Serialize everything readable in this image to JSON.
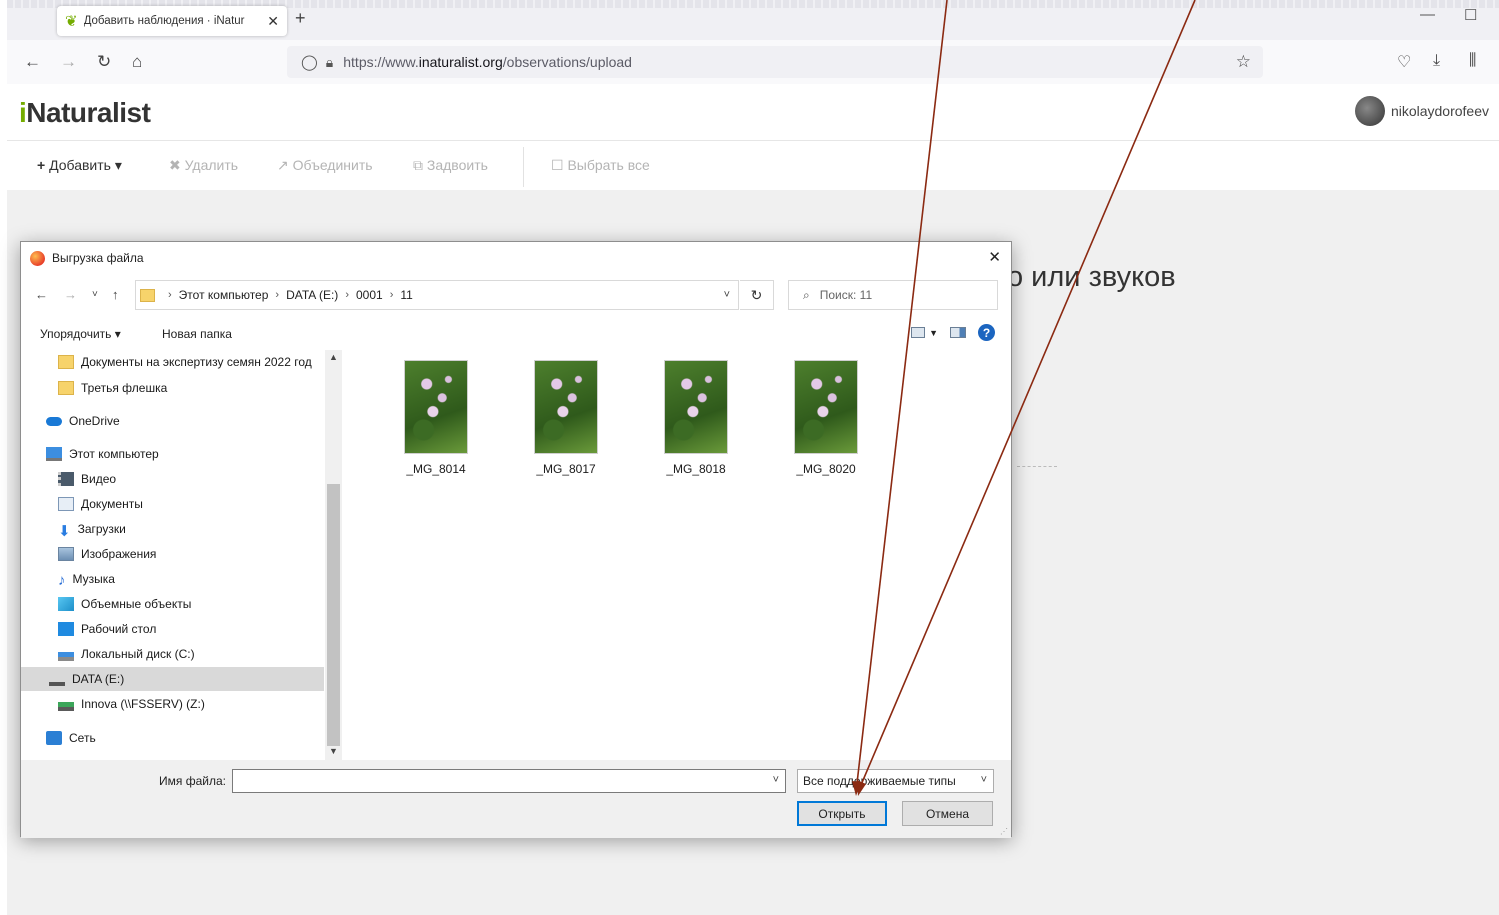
{
  "browser": {
    "tab_title": "Добавить наблюдения · iNatur",
    "tab_close": "✕",
    "new_tab": "+",
    "url_prefix": "https://www.",
    "url_domain": "inaturalist.org",
    "url_path": "/observations/upload"
  },
  "site": {
    "logo_i": "i",
    "logo_rest": "Naturalist",
    "username": "nikolaydorofeev",
    "toolbar": {
      "add": "Добавить",
      "delete": "Удалить",
      "merge": "Объединить",
      "duplicate": "Задвоить",
      "select_all": "Выбрать все"
    },
    "heading_partial": "о или звуков"
  },
  "dialog": {
    "title": "Выгрузка файла",
    "breadcrumb": [
      "Этот компьютер",
      "DATA (E:)",
      "0001",
      "11"
    ],
    "search_placeholder": "Поиск: 11",
    "organize": "Упорядочить ▾",
    "new_folder": "Новая папка",
    "nav_items": [
      {
        "label": "Документы на экспертизу семян 2022 год",
        "icon": "folder-icon"
      },
      {
        "label": "Третья флешка",
        "icon": "folder-icon"
      },
      {
        "label": "OneDrive",
        "icon": "cloud-icon"
      },
      {
        "label": "Этот компьютер",
        "icon": "computer-icon"
      },
      {
        "label": "Видео",
        "icon": "video-icon"
      },
      {
        "label": "Документы",
        "icon": "documents-icon"
      },
      {
        "label": "Загрузки",
        "icon": "download-icon"
      },
      {
        "label": "Изображения",
        "icon": "pictures-icon"
      },
      {
        "label": "Музыка",
        "icon": "music-icon"
      },
      {
        "label": "Объемные объекты",
        "icon": "3d-objects-icon"
      },
      {
        "label": "Рабочий стол",
        "icon": "desktop-icon"
      },
      {
        "label": "Локальный диск (C:)",
        "icon": "drive-icon"
      },
      {
        "label": "DATA (E:)",
        "icon": "drive-icon"
      },
      {
        "label": "Innova (\\\\FSSERV) (Z:)",
        "icon": "network-drive-icon"
      },
      {
        "label": "Сеть",
        "icon": "network-icon"
      }
    ],
    "files": [
      "_MG_8014",
      "_MG_8017",
      "_MG_8018",
      "_MG_8020"
    ],
    "filename_label": "Имя файла:",
    "filename_value": "",
    "filetype": "Все поддерживаемые типы",
    "open_button": "Открыть",
    "cancel_button": "Отмена"
  },
  "colors": {
    "inat_green": "#74ac00",
    "annotation_arrow": "#8b2a12",
    "open_button_border": "#0078d7"
  }
}
